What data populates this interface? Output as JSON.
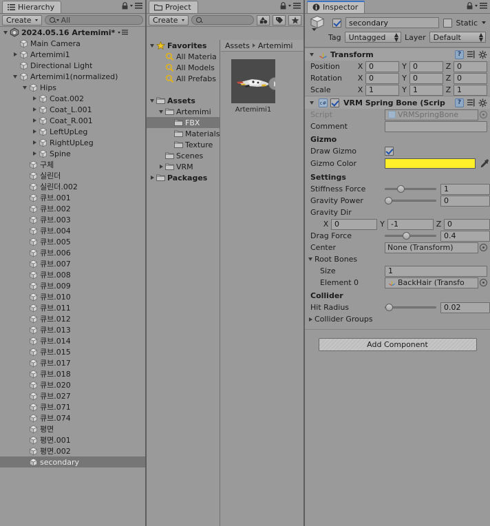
{
  "hierarchy": {
    "tab_label": "Hierarchy",
    "create_label": "Create",
    "search_placeholder": "All",
    "scene_name": "2024.05.16 Artemimi*",
    "items": [
      {
        "label": "Main Camera",
        "indent": 1,
        "arrow": "none"
      },
      {
        "label": "Artemimi1",
        "indent": 1,
        "arrow": "closed"
      },
      {
        "label": "Directional Light",
        "indent": 1,
        "arrow": "none"
      },
      {
        "label": "Artemimi1(normalized)",
        "indent": 1,
        "arrow": "open"
      },
      {
        "label": "Hips",
        "indent": 2,
        "arrow": "open"
      },
      {
        "label": "Coat.002",
        "indent": 3,
        "arrow": "closed"
      },
      {
        "label": "Coat_L.001",
        "indent": 3,
        "arrow": "closed"
      },
      {
        "label": "Coat_R.001",
        "indent": 3,
        "arrow": "closed"
      },
      {
        "label": "LeftUpLeg",
        "indent": 3,
        "arrow": "closed"
      },
      {
        "label": "RightUpLeg",
        "indent": 3,
        "arrow": "closed"
      },
      {
        "label": "Spine",
        "indent": 3,
        "arrow": "closed"
      },
      {
        "label": "구체",
        "indent": 2,
        "arrow": "none"
      },
      {
        "label": "실린더",
        "indent": 2,
        "arrow": "none"
      },
      {
        "label": "실린더.002",
        "indent": 2,
        "arrow": "none"
      },
      {
        "label": "큐브.001",
        "indent": 2,
        "arrow": "none"
      },
      {
        "label": "큐브.002",
        "indent": 2,
        "arrow": "none"
      },
      {
        "label": "큐브.003",
        "indent": 2,
        "arrow": "none"
      },
      {
        "label": "큐브.004",
        "indent": 2,
        "arrow": "none"
      },
      {
        "label": "큐브.005",
        "indent": 2,
        "arrow": "none"
      },
      {
        "label": "큐브.006",
        "indent": 2,
        "arrow": "none"
      },
      {
        "label": "큐브.007",
        "indent": 2,
        "arrow": "none"
      },
      {
        "label": "큐브.008",
        "indent": 2,
        "arrow": "none"
      },
      {
        "label": "큐브.009",
        "indent": 2,
        "arrow": "none"
      },
      {
        "label": "큐브.010",
        "indent": 2,
        "arrow": "none"
      },
      {
        "label": "큐브.011",
        "indent": 2,
        "arrow": "none"
      },
      {
        "label": "큐브.012",
        "indent": 2,
        "arrow": "none"
      },
      {
        "label": "큐브.013",
        "indent": 2,
        "arrow": "none"
      },
      {
        "label": "큐브.014",
        "indent": 2,
        "arrow": "none"
      },
      {
        "label": "큐브.015",
        "indent": 2,
        "arrow": "none"
      },
      {
        "label": "큐브.017",
        "indent": 2,
        "arrow": "none"
      },
      {
        "label": "큐브.018",
        "indent": 2,
        "arrow": "none"
      },
      {
        "label": "큐브.020",
        "indent": 2,
        "arrow": "none"
      },
      {
        "label": "큐브.027",
        "indent": 2,
        "arrow": "none"
      },
      {
        "label": "큐브.071",
        "indent": 2,
        "arrow": "none"
      },
      {
        "label": "큐브.074",
        "indent": 2,
        "arrow": "none"
      },
      {
        "label": "평면",
        "indent": 2,
        "arrow": "none"
      },
      {
        "label": "평면.001",
        "indent": 2,
        "arrow": "none"
      },
      {
        "label": "평면.002",
        "indent": 2,
        "arrow": "none"
      },
      {
        "label": "secondary",
        "indent": 2,
        "arrow": "none",
        "selected": true
      }
    ]
  },
  "project": {
    "tab_label": "Project",
    "create_label": "Create",
    "search_placeholder": "",
    "tree": [
      {
        "label": "Favorites",
        "indent": 0,
        "arrow": "open",
        "icon": "star",
        "bold": true
      },
      {
        "label": "All Materia",
        "indent": 1,
        "arrow": "none",
        "icon": "favmag"
      },
      {
        "label": "All Models",
        "indent": 1,
        "arrow": "none",
        "icon": "favmag"
      },
      {
        "label": "All Prefabs",
        "indent": 1,
        "arrow": "none",
        "icon": "favmag"
      },
      {
        "label": "",
        "indent": 0,
        "arrow": "none",
        "icon": "none"
      },
      {
        "label": "Assets",
        "indent": 0,
        "arrow": "open",
        "icon": "folder",
        "bold": true
      },
      {
        "label": "Artemimi",
        "indent": 1,
        "arrow": "open",
        "icon": "folder"
      },
      {
        "label": "FBX",
        "indent": 2,
        "arrow": "none",
        "icon": "folder",
        "selected": true
      },
      {
        "label": "Materials",
        "indent": 2,
        "arrow": "none",
        "icon": "folder"
      },
      {
        "label": "Texture",
        "indent": 2,
        "arrow": "none",
        "icon": "folder"
      },
      {
        "label": "Scenes",
        "indent": 1,
        "arrow": "none",
        "icon": "folder"
      },
      {
        "label": "VRM",
        "indent": 1,
        "arrow": "closed",
        "icon": "folder"
      },
      {
        "label": "Packages",
        "indent": 0,
        "arrow": "closed",
        "icon": "folder",
        "bold": true
      }
    ],
    "breadcrumb": [
      "Assets",
      "Artemimi"
    ],
    "asset": {
      "name": "Artemimi1"
    }
  },
  "inspector": {
    "tab_label": "Inspector",
    "object_name": "secondary",
    "enabled": true,
    "static_label": "Static",
    "static_checked": false,
    "tag_label": "Tag",
    "tag_value": "Untagged",
    "layer_label": "Layer",
    "layer_value": "Default",
    "transform": {
      "title": "Transform",
      "rows": [
        {
          "label": "Position",
          "x": "0",
          "y": "0",
          "z": "0"
        },
        {
          "label": "Rotation",
          "x": "0",
          "y": "0",
          "z": "0"
        },
        {
          "label": "Scale",
          "x": "1",
          "y": "1",
          "z": "1"
        }
      ],
      "axis_labels": [
        "X",
        "Y",
        "Z"
      ]
    },
    "springbone": {
      "title": "VRM Spring Bone (Scrip",
      "enabled": true,
      "script_label": "Script",
      "script_value": "VRMSpringBone",
      "comment_label": "Comment",
      "comment_value": "",
      "gizmo_header": "Gizmo",
      "draw_gizmo_label": "Draw Gizmo",
      "draw_gizmo_checked": true,
      "gizmo_color_label": "Gizmo Color",
      "gizmo_color": "#FFF02A",
      "settings_header": "Settings",
      "stiffness_label": "Stiffness Force",
      "stiffness_value": "1",
      "stiffness_pct": 28,
      "gravity_power_label": "Gravity Power",
      "gravity_power_value": "0",
      "gravity_power_pct": 0,
      "gravity_dir_label": "Gravity Dir",
      "gravity_dir": {
        "x": "0",
        "y": "-1",
        "z": "0"
      },
      "drag_force_label": "Drag Force",
      "drag_force_value": "0.4",
      "drag_force_pct": 40,
      "center_label": "Center",
      "center_value": "None (Transform)",
      "root_bones_label": "Root Bones",
      "size_label": "Size",
      "size_value": "1",
      "element0_label": "Element 0",
      "element0_value": "BackHair (Transfo",
      "collider_header": "Collider",
      "hit_radius_label": "Hit Radius",
      "hit_radius_value": "0.02",
      "hit_radius_pct": 2,
      "collider_groups_label": "Collider Groups"
    },
    "add_component_label": "Add Component"
  }
}
